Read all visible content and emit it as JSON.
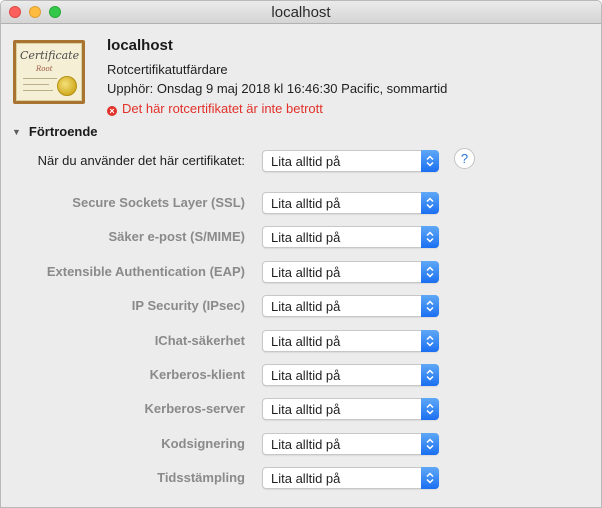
{
  "window": {
    "title": "localhost"
  },
  "certificate": {
    "icon_text": "Certificate",
    "icon_subtext": "Root",
    "name": "localhost",
    "type": "Rotcertifikatutfärdare",
    "expiry": "Upphör: Onsdag 9 maj 2018 kl 16:46:30 Pacific, sommartid",
    "status": "Det här rotcertifikatet är inte betrott"
  },
  "trust": {
    "section_label": "Förtroende",
    "main_label": "När du använder det här certifikatet:",
    "main_value": "Lita alltid på",
    "help_label": "?",
    "rows": [
      {
        "label": "Secure Sockets Layer (SSL)",
        "value": "Lita alltid på"
      },
      {
        "label": "Säker e-post (S/MIME)",
        "value": "Lita alltid på"
      },
      {
        "label": "Extensible Authentication (EAP)",
        "value": "Lita alltid på"
      },
      {
        "label": "IP Security (IPsec)",
        "value": "Lita alltid på"
      },
      {
        "label": "IChat-säkerhet",
        "value": "Lita alltid på"
      },
      {
        "label": "Kerberos-klient",
        "value": "Lita alltid på"
      },
      {
        "label": "Kerberos-server",
        "value": "Lita alltid på"
      },
      {
        "label": "Kodsignering",
        "value": "Lita alltid på"
      },
      {
        "label": "Tidsstämpling",
        "value": "Lita alltid på"
      }
    ]
  },
  "colors": {
    "error_red": "#e2312a",
    "accent_blue": "#1a6ff2"
  }
}
